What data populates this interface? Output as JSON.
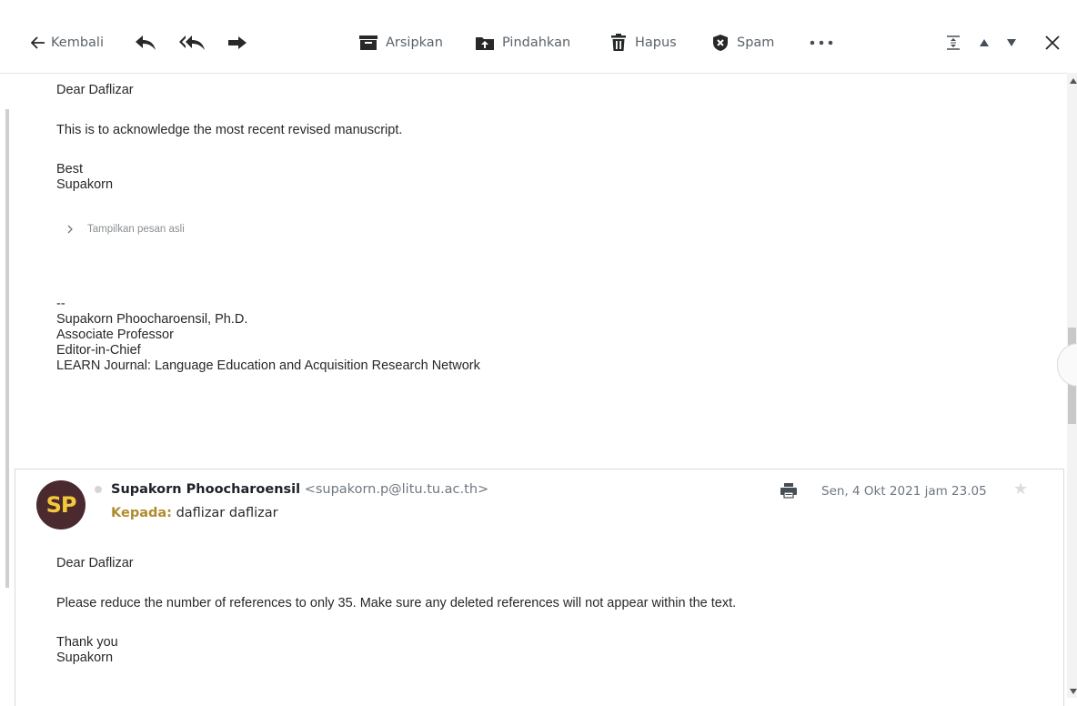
{
  "toolbar": {
    "back_label": "Kembali",
    "archive_label": "Arsipkan",
    "move_label": "Pindahkan",
    "delete_label": "Hapus",
    "spam_label": "Spam"
  },
  "message1": {
    "greeting": "Dear Daflizar",
    "line1": "This is to acknowledge the most recent revised manuscript.",
    "closing1": "Best",
    "closing2": "Supakorn",
    "show_original": "Tampilkan pesan asli",
    "sig_sep": "--",
    "sig_name": "Supakorn Phoocharoensil, Ph.D.",
    "sig_title": "Associate Professor",
    "sig_role": "Editor-in-Chief",
    "sig_journal": "LEARN Journal: Language Education and Acquisition Research Network"
  },
  "message2": {
    "avatar_initials": "SP",
    "sender_name": "Supakorn Phoocharoensil",
    "sender_email": "<supakorn.p@litu.tu.ac.th>",
    "to_label": "Kepada:",
    "to_value": "daflizar daflizar",
    "date": "Sen, 4 Okt 2021 jam 23.05",
    "greeting": "Dear Daflizar",
    "line1": "Please reduce the number of references to only 35. Make sure any deleted references will not appear within the text.",
    "closing1": "Thank you",
    "closing2": "Supakorn"
  },
  "colors": {
    "avatar_bg": "#4a2a2e",
    "avatar_text": "#f3c93a",
    "to_label": "#b08b2e"
  }
}
